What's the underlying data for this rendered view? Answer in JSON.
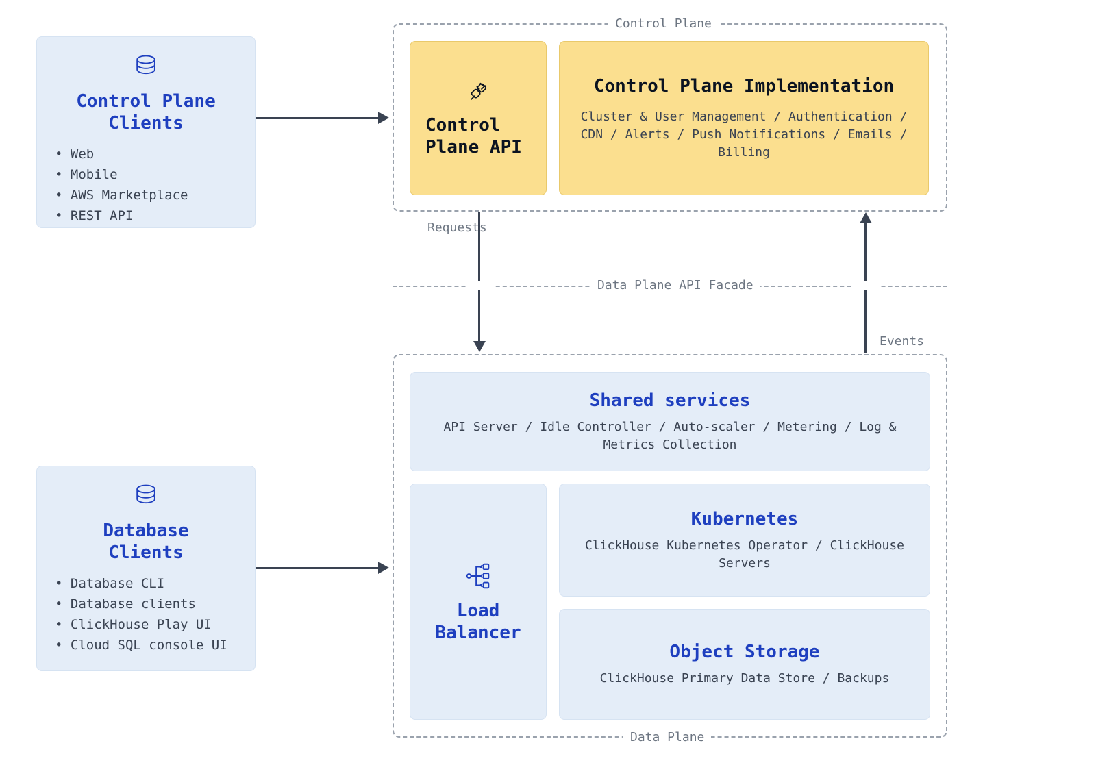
{
  "clients": {
    "control": {
      "title": "Control Plane\nClients",
      "items": [
        "Web",
        "Mobile",
        "AWS Marketplace",
        "REST API"
      ]
    },
    "database": {
      "title": "Database\nClients",
      "items": [
        "Database CLI",
        "Database clients",
        "ClickHouse Play UI",
        "Cloud SQL console UI"
      ]
    }
  },
  "control_plane": {
    "frame_label": "Control Plane",
    "api": {
      "title": "Control\nPlane API"
    },
    "impl": {
      "title": "Control Plane Implementation",
      "desc": "Cluster & User Management / Authentication / CDN / Alerts / Push Notifications / Emails / Billing"
    }
  },
  "facade": {
    "label": "Data Plane API Facade"
  },
  "labels": {
    "requests": "Requests",
    "events": "Events"
  },
  "data_plane": {
    "frame_label": "Data Plane",
    "shared": {
      "title": "Shared services",
      "desc": "API Server / Idle Controller / Auto-scaler / Metering / Log & Metrics Collection"
    },
    "lb": {
      "title": "Load\nBalancer"
    },
    "k8s": {
      "title": "Kubernetes",
      "desc": "ClickHouse Kubernetes Operator / ClickHouse Servers"
    },
    "obj": {
      "title": "Object Storage",
      "desc": "ClickHouse Primary Data Store / Backups"
    }
  }
}
